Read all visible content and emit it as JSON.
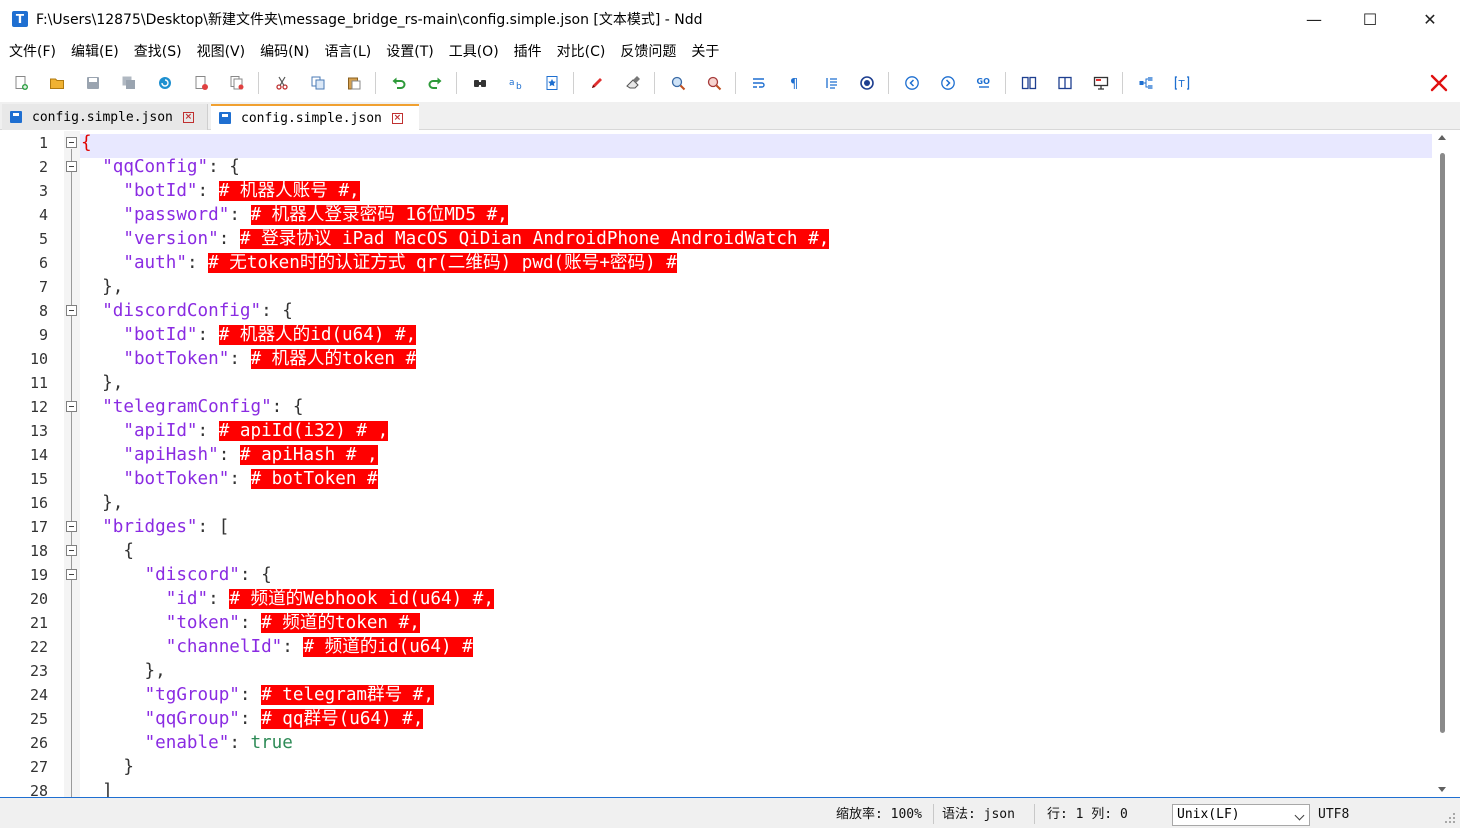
{
  "window": {
    "title": "F:\\Users\\12875\\Desktop\\新建文件夹\\message_bridge_rs-main\\config.simple.json [文本模式] - Ndd",
    "app_icon_letter": "T",
    "minimize_glyph": "—",
    "maximize_glyph": "☐",
    "close_glyph": "✕"
  },
  "menu": [
    "文件(F)",
    "编辑(E)",
    "查找(S)",
    "视图(V)",
    "编码(N)",
    "语言(L)",
    "设置(T)",
    "工具(O)",
    "插件",
    "对比(C)",
    "反馈问题",
    "关于"
  ],
  "tabs": [
    {
      "label": "config.simple.json",
      "active": false
    },
    {
      "label": "config.simple.json",
      "active": true
    }
  ],
  "tab_close_glyph": "×",
  "editor": {
    "lines": [
      [
        {
          "t": "{",
          "c": "brace-first"
        }
      ],
      [
        {
          "t": "  ",
          "c": "p"
        },
        {
          "t": "\"qqConfig\"",
          "c": "k"
        },
        {
          "t": ": {",
          "c": "p"
        }
      ],
      [
        {
          "t": "    ",
          "c": "p"
        },
        {
          "t": "\"botId\"",
          "c": "k"
        },
        {
          "t": ": ",
          "c": "p"
        },
        {
          "t": "# 机器人账号 #,",
          "c": "ph"
        }
      ],
      [
        {
          "t": "    ",
          "c": "p"
        },
        {
          "t": "\"password\"",
          "c": "k"
        },
        {
          "t": ": ",
          "c": "p"
        },
        {
          "t": "# 机器人登录密码 16位MD5 #,",
          "c": "ph"
        }
      ],
      [
        {
          "t": "    ",
          "c": "p"
        },
        {
          "t": "\"version\"",
          "c": "k"
        },
        {
          "t": ": ",
          "c": "p"
        },
        {
          "t": "# 登录协议 iPad MacOS QiDian AndroidPhone AndroidWatch #,",
          "c": "ph"
        }
      ],
      [
        {
          "t": "    ",
          "c": "p"
        },
        {
          "t": "\"auth\"",
          "c": "k"
        },
        {
          "t": ": ",
          "c": "p"
        },
        {
          "t": "# 无token时的认证方式 qr(二维码) pwd(账号+密码) #",
          "c": "ph"
        }
      ],
      [
        {
          "t": "  },",
          "c": "p"
        }
      ],
      [
        {
          "t": "  ",
          "c": "p"
        },
        {
          "t": "\"discordConfig\"",
          "c": "k"
        },
        {
          "t": ": {",
          "c": "p"
        }
      ],
      [
        {
          "t": "    ",
          "c": "p"
        },
        {
          "t": "\"botId\"",
          "c": "k"
        },
        {
          "t": ": ",
          "c": "p"
        },
        {
          "t": "# 机器人的id(u64) #,",
          "c": "ph"
        }
      ],
      [
        {
          "t": "    ",
          "c": "p"
        },
        {
          "t": "\"botToken\"",
          "c": "k"
        },
        {
          "t": ": ",
          "c": "p"
        },
        {
          "t": "# 机器人的token #",
          "c": "ph"
        }
      ],
      [
        {
          "t": "  },",
          "c": "p"
        }
      ],
      [
        {
          "t": "  ",
          "c": "p"
        },
        {
          "t": "\"telegramConfig\"",
          "c": "k"
        },
        {
          "t": ": {",
          "c": "p"
        }
      ],
      [
        {
          "t": "    ",
          "c": "p"
        },
        {
          "t": "\"apiId\"",
          "c": "k"
        },
        {
          "t": ": ",
          "c": "p"
        },
        {
          "t": "# apiId(i32) # ,",
          "c": "ph"
        }
      ],
      [
        {
          "t": "    ",
          "c": "p"
        },
        {
          "t": "\"apiHash\"",
          "c": "k"
        },
        {
          "t": ": ",
          "c": "p"
        },
        {
          "t": "# apiHash # ,",
          "c": "ph"
        }
      ],
      [
        {
          "t": "    ",
          "c": "p"
        },
        {
          "t": "\"botToken\"",
          "c": "k"
        },
        {
          "t": ": ",
          "c": "p"
        },
        {
          "t": "# botToken #",
          "c": "ph"
        }
      ],
      [
        {
          "t": "  },",
          "c": "p"
        }
      ],
      [
        {
          "t": "  ",
          "c": "p"
        },
        {
          "t": "\"bridges\"",
          "c": "k"
        },
        {
          "t": ": [",
          "c": "p"
        }
      ],
      [
        {
          "t": "    {",
          "c": "p"
        }
      ],
      [
        {
          "t": "      ",
          "c": "p"
        },
        {
          "t": "\"discord\"",
          "c": "k"
        },
        {
          "t": ": {",
          "c": "p"
        }
      ],
      [
        {
          "t": "        ",
          "c": "p"
        },
        {
          "t": "\"id\"",
          "c": "k"
        },
        {
          "t": ": ",
          "c": "p"
        },
        {
          "t": "# 频道的Webhook id(u64) #,",
          "c": "ph"
        }
      ],
      [
        {
          "t": "        ",
          "c": "p"
        },
        {
          "t": "\"token\"",
          "c": "k"
        },
        {
          "t": ": ",
          "c": "p"
        },
        {
          "t": "# 频道的token #,",
          "c": "ph"
        }
      ],
      [
        {
          "t": "        ",
          "c": "p"
        },
        {
          "t": "\"channelId\"",
          "c": "k"
        },
        {
          "t": ": ",
          "c": "p"
        },
        {
          "t": "# 频道的id(u64) #",
          "c": "ph"
        }
      ],
      [
        {
          "t": "      },",
          "c": "p"
        }
      ],
      [
        {
          "t": "      ",
          "c": "p"
        },
        {
          "t": "\"tgGroup\"",
          "c": "k"
        },
        {
          "t": ": ",
          "c": "p"
        },
        {
          "t": "# telegram群号 #,",
          "c": "ph"
        }
      ],
      [
        {
          "t": "      ",
          "c": "p"
        },
        {
          "t": "\"qqGroup\"",
          "c": "k"
        },
        {
          "t": ": ",
          "c": "p"
        },
        {
          "t": "# qq群号(u64) #,",
          "c": "ph"
        }
      ],
      [
        {
          "t": "      ",
          "c": "p"
        },
        {
          "t": "\"enable\"",
          "c": "k"
        },
        {
          "t": ": ",
          "c": "p"
        },
        {
          "t": "true",
          "c": "b"
        }
      ],
      [
        {
          "t": "    }",
          "c": "p"
        }
      ],
      [
        {
          "t": "  ]",
          "c": "p"
        }
      ]
    ],
    "fold_lines": [
      1,
      2,
      8,
      12,
      17,
      18,
      19
    ]
  },
  "status": {
    "zoom_label": "缩放率: 100%",
    "language_label": "语法: json",
    "cursor_label": "行: 1  列: 0",
    "eol": "Unix(LF)",
    "encoding": "UTF8"
  },
  "colors": {
    "key": "#8a2be2",
    "placeholder_bg": "#ff0000",
    "boolean": "#2e8b57",
    "accent": "#1f6fd1"
  }
}
